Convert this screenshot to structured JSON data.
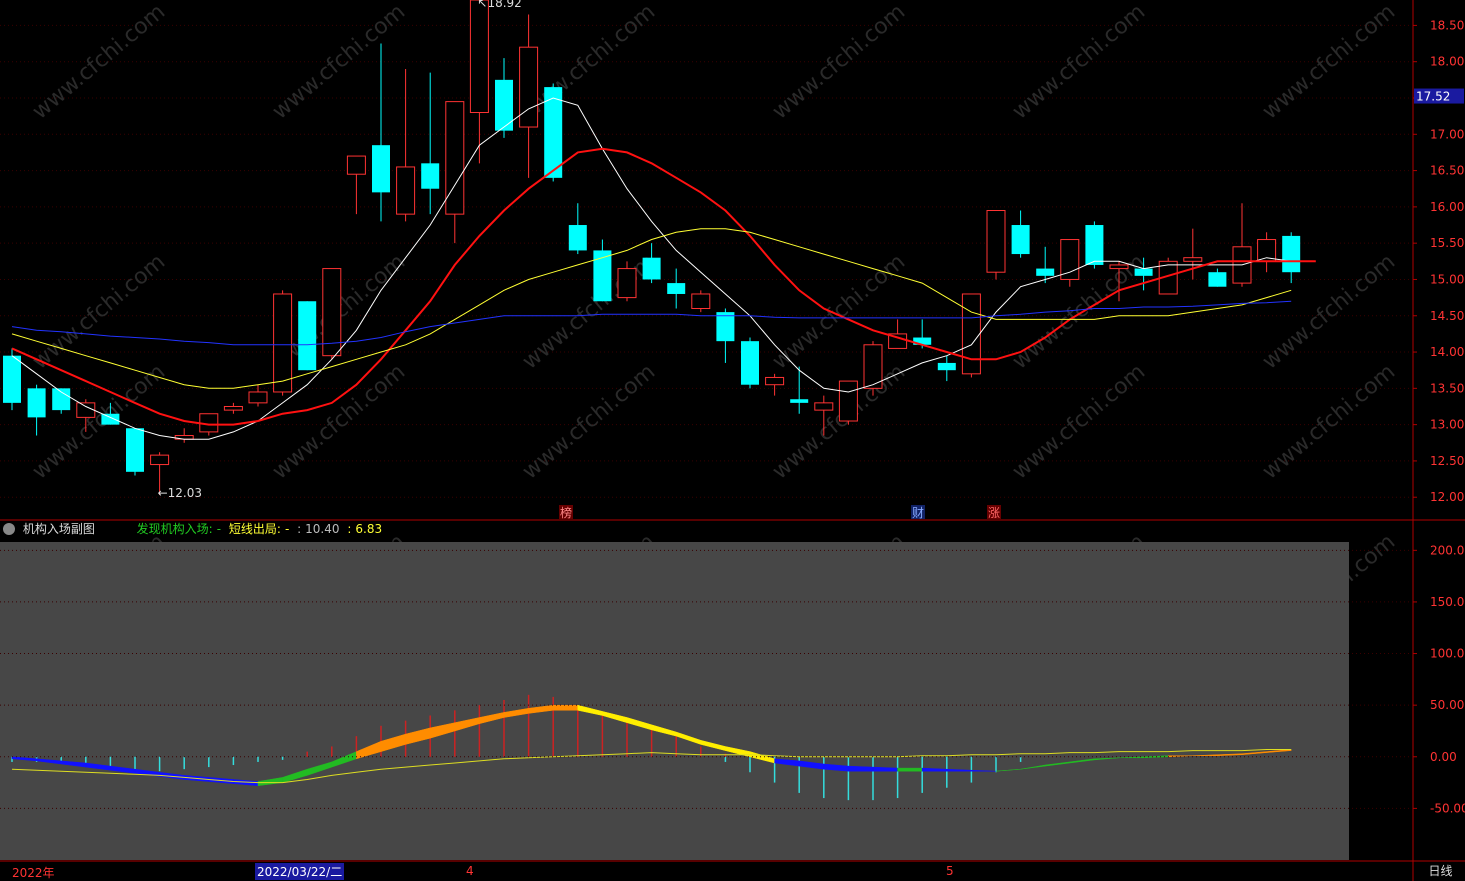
{
  "main_chart": {
    "price_axis_labels": [
      "18.50",
      "18.00",
      "17.50",
      "17.00",
      "16.50",
      "16.00",
      "15.50",
      "15.00",
      "14.50",
      "14.00",
      "13.50",
      "13.00",
      "12.50",
      "12.00"
    ],
    "current_price_tag": "17.52",
    "high_marker": "18.92",
    "low_marker": "12.03",
    "event_tags": [
      "榜",
      "财",
      "涨"
    ],
    "watermark": "www.cfchi.com"
  },
  "sub_chart": {
    "title": "机构入场副图",
    "legend": [
      {
        "label": "发现机构入场:",
        "value": "-",
        "color": "#22cc22"
      },
      {
        "label": "短线出局:",
        "value": "-",
        "color": "#ffff33"
      },
      {
        "label": ":",
        "value": "10.40",
        "color": "#bbbbbb"
      },
      {
        "label": ":",
        "value": "6.83",
        "color": "#ffff33"
      }
    ],
    "axis_labels": [
      "200.00",
      "150.00",
      "100.00",
      "50.00",
      "0.00",
      "-50.00"
    ]
  },
  "time_axis": {
    "labels": [
      "2022年",
      "2022/03/22/二",
      "4",
      "5"
    ],
    "period": "日线"
  },
  "chart_data": [
    {
      "type": "candlestick",
      "title": "",
      "ylim": [
        11.7,
        18.85
      ],
      "up_color": "#ff3333",
      "down_color": "#00ffff",
      "candles": [
        {
          "o": 13.95,
          "h": 14.05,
          "l": 13.2,
          "c": 13.3
        },
        {
          "o": 13.5,
          "h": 13.55,
          "l": 12.85,
          "c": 13.1
        },
        {
          "o": 13.5,
          "h": 13.5,
          "l": 13.15,
          "c": 13.2
        },
        {
          "o": 13.1,
          "h": 13.35,
          "l": 12.9,
          "c": 13.3
        },
        {
          "o": 13.15,
          "h": 13.3,
          "l": 13.0,
          "c": 13.0
        },
        {
          "o": 12.95,
          "h": 12.95,
          "l": 12.3,
          "c": 12.35
        },
        {
          "o": 12.45,
          "h": 12.62,
          "l": 12.03,
          "c": 12.58
        },
        {
          "o": 12.8,
          "h": 12.95,
          "l": 12.75,
          "c": 12.85
        },
        {
          "o": 12.9,
          "h": 13.15,
          "l": 12.85,
          "c": 13.15
        },
        {
          "o": 13.2,
          "h": 13.3,
          "l": 13.15,
          "c": 13.25
        },
        {
          "o": 13.3,
          "h": 13.55,
          "l": 13.25,
          "c": 13.45
        },
        {
          "o": 13.45,
          "h": 14.85,
          "l": 13.4,
          "c": 14.8
        },
        {
          "o": 14.7,
          "h": 14.7,
          "l": 13.75,
          "c": 13.75
        },
        {
          "o": 13.95,
          "h": 15.15,
          "l": 13.9,
          "c": 15.15
        },
        {
          "o": 16.45,
          "h": 16.7,
          "l": 15.9,
          "c": 16.7
        },
        {
          "o": 16.85,
          "h": 18.25,
          "l": 15.8,
          "c": 16.2
        },
        {
          "o": 15.9,
          "h": 17.9,
          "l": 15.8,
          "c": 16.55
        },
        {
          "o": 16.6,
          "h": 17.85,
          "l": 15.9,
          "c": 16.25
        },
        {
          "o": 15.9,
          "h": 17.45,
          "l": 15.5,
          "c": 17.45
        },
        {
          "o": 17.3,
          "h": 18.92,
          "l": 16.6,
          "c": 18.85
        },
        {
          "o": 17.75,
          "h": 18.05,
          "l": 16.95,
          "c": 17.05
        },
        {
          "o": 17.1,
          "h": 18.65,
          "l": 16.4,
          "c": 18.2
        },
        {
          "o": 17.65,
          "h": 17.7,
          "l": 16.35,
          "c": 16.4
        },
        {
          "o": 15.75,
          "h": 16.05,
          "l": 15.35,
          "c": 15.4
        },
        {
          "o": 15.4,
          "h": 15.55,
          "l": 14.7,
          "c": 14.7
        },
        {
          "o": 14.75,
          "h": 15.25,
          "l": 14.7,
          "c": 15.15
        },
        {
          "o": 15.3,
          "h": 15.5,
          "l": 14.95,
          "c": 15.0
        },
        {
          "o": 14.95,
          "h": 15.15,
          "l": 14.6,
          "c": 14.8
        },
        {
          "o": 14.6,
          "h": 14.85,
          "l": 14.55,
          "c": 14.8
        },
        {
          "o": 14.55,
          "h": 14.6,
          "l": 13.85,
          "c": 14.15
        },
        {
          "o": 14.15,
          "h": 14.2,
          "l": 13.5,
          "c": 13.55
        },
        {
          "o": 13.55,
          "h": 13.7,
          "l": 13.4,
          "c": 13.65
        },
        {
          "o": 13.35,
          "h": 13.8,
          "l": 13.15,
          "c": 13.3
        },
        {
          "o": 13.2,
          "h": 13.4,
          "l": 12.85,
          "c": 13.3
        },
        {
          "o": 13.05,
          "h": 13.55,
          "l": 13.0,
          "c": 13.6
        },
        {
          "o": 13.5,
          "h": 14.15,
          "l": 13.4,
          "c": 14.1
        },
        {
          "o": 14.05,
          "h": 14.45,
          "l": 14.05,
          "c": 14.25
        },
        {
          "o": 14.2,
          "h": 14.45,
          "l": 14.05,
          "c": 14.1
        },
        {
          "o": 13.85,
          "h": 13.95,
          "l": 13.6,
          "c": 13.75
        },
        {
          "o": 13.7,
          "h": 14.8,
          "l": 13.65,
          "c": 14.8
        },
        {
          "o": 15.1,
          "h": 15.95,
          "l": 15.0,
          "c": 15.95
        },
        {
          "o": 15.75,
          "h": 15.95,
          "l": 15.3,
          "c": 15.35
        },
        {
          "o": 15.15,
          "h": 15.45,
          "l": 14.95,
          "c": 15.05
        },
        {
          "o": 15.0,
          "h": 15.55,
          "l": 14.9,
          "c": 15.55
        },
        {
          "o": 15.75,
          "h": 15.8,
          "l": 15.15,
          "c": 15.2
        },
        {
          "o": 15.15,
          "h": 15.25,
          "l": 14.7,
          "c": 15.2
        },
        {
          "o": 15.15,
          "h": 15.3,
          "l": 14.85,
          "c": 15.05
        },
        {
          "o": 14.8,
          "h": 15.3,
          "l": 14.8,
          "c": 15.25
        },
        {
          "o": 15.25,
          "h": 15.7,
          "l": 15.0,
          "c": 15.3
        },
        {
          "o": 15.1,
          "h": 15.15,
          "l": 14.9,
          "c": 14.9
        },
        {
          "o": 14.95,
          "h": 16.05,
          "l": 14.9,
          "c": 15.45
        },
        {
          "o": 15.25,
          "h": 15.65,
          "l": 15.1,
          "c": 15.55
        },
        {
          "o": 15.6,
          "h": 15.65,
          "l": 14.95,
          "c": 15.1
        }
      ],
      "series": [
        {
          "color": "#ffffff",
          "width": 1,
          "values": [
            13.95,
            13.7,
            13.45,
            13.25,
            13.1,
            12.95,
            12.85,
            12.8,
            12.8,
            12.9,
            13.05,
            13.3,
            13.55,
            13.9,
            14.3,
            14.85,
            15.3,
            15.75,
            16.3,
            16.85,
            17.1,
            17.35,
            17.5,
            17.4,
            16.8,
            16.25,
            15.8,
            15.4,
            15.1,
            14.8,
            14.5,
            14.1,
            13.75,
            13.5,
            13.45,
            13.55,
            13.7,
            13.85,
            13.95,
            14.1,
            14.55,
            14.9,
            15.0,
            15.1,
            15.25,
            15.25,
            15.15,
            15.2,
            15.2,
            15.2,
            15.2,
            15.3,
            15.25
          ]
        },
        {
          "color": "#ff1111",
          "width": 2,
          "values": [
            14.05,
            13.9,
            13.75,
            13.6,
            13.45,
            13.3,
            13.15,
            13.05,
            13.0,
            13.0,
            13.05,
            13.15,
            13.2,
            13.3,
            13.55,
            13.9,
            14.3,
            14.7,
            15.2,
            15.6,
            15.95,
            16.25,
            16.5,
            16.75,
            16.8,
            16.75,
            16.6,
            16.4,
            16.2,
            15.95,
            15.6,
            15.2,
            14.85,
            14.6,
            14.45,
            14.3,
            14.2,
            14.1,
            14.0,
            13.9,
            13.9,
            14.0,
            14.2,
            14.45,
            14.65,
            14.85,
            14.95,
            15.05,
            15.15,
            15.25,
            15.25,
            15.25,
            15.25,
            15.25
          ]
        },
        {
          "color": "#ffff33",
          "width": 1,
          "values": [
            14.25,
            14.15,
            14.05,
            13.95,
            13.85,
            13.75,
            13.65,
            13.55,
            13.5,
            13.5,
            13.55,
            13.6,
            13.7,
            13.8,
            13.9,
            14.0,
            14.1,
            14.25,
            14.45,
            14.65,
            14.85,
            15.0,
            15.1,
            15.2,
            15.3,
            15.4,
            15.55,
            15.65,
            15.7,
            15.7,
            15.65,
            15.55,
            15.45,
            15.35,
            15.25,
            15.15,
            15.05,
            14.95,
            14.75,
            14.55,
            14.45,
            14.45,
            14.45,
            14.45,
            14.45,
            14.5,
            14.5,
            14.5,
            14.55,
            14.6,
            14.65,
            14.75,
            14.85
          ]
        },
        {
          "color": "#2233ff",
          "width": 1,
          "values": [
            14.35,
            14.3,
            14.28,
            14.25,
            14.22,
            14.2,
            14.18,
            14.15,
            14.13,
            14.1,
            14.1,
            14.1,
            14.1,
            14.12,
            14.15,
            14.2,
            14.28,
            14.35,
            14.4,
            14.45,
            14.5,
            14.5,
            14.5,
            14.5,
            14.52,
            14.52,
            14.52,
            14.52,
            14.5,
            14.5,
            14.5,
            14.48,
            14.47,
            14.47,
            14.47,
            14.47,
            14.47,
            14.47,
            14.47,
            14.47,
            14.5,
            14.52,
            14.55,
            14.57,
            14.6,
            14.6,
            14.62,
            14.62,
            14.63,
            14.65,
            14.67,
            14.68,
            14.7
          ]
        }
      ]
    },
    {
      "type": "area",
      "title": "机构入场副图",
      "ylim": [
        -100,
        210
      ],
      "upper": [
        0,
        -2,
        -4,
        -6,
        -9,
        -12,
        -15,
        -18,
        -20,
        -22,
        -24,
        -20,
        -12,
        -5,
        5,
        15,
        22,
        28,
        33,
        38,
        43,
        47,
        50,
        50,
        44,
        38,
        31,
        24,
        16,
        10,
        5,
        -2,
        -4,
        -7,
        -9,
        -10,
        -11,
        -11,
        -12,
        -13,
        -14,
        -12,
        -8,
        -5,
        -2,
        -1,
        0,
        1,
        1,
        2,
        3,
        5,
        7
      ],
      "lower": [
        -2,
        -4,
        -7,
        -10,
        -13,
        -16,
        -19,
        -22,
        -24,
        -26,
        -28,
        -25,
        -18,
        -10,
        -2,
        5,
        12,
        18,
        25,
        32,
        38,
        42,
        45,
        45,
        40,
        33,
        26,
        20,
        12,
        6,
        0,
        -6,
        -9,
        -12,
        -14,
        -14,
        -14,
        -14,
        -14,
        -14,
        -14,
        -12,
        -9,
        -6,
        -3,
        -1,
        -1,
        0,
        1,
        1,
        2,
        4,
        6
      ],
      "pos_bars": [
        0,
        0,
        0,
        0,
        0,
        0,
        0,
        0,
        0,
        0,
        0,
        0,
        5,
        10,
        20,
        30,
        35,
        40,
        45,
        50,
        55,
        60,
        58,
        50,
        40,
        35,
        30,
        20,
        10,
        3,
        0,
        0,
        0,
        0,
        0,
        0,
        0,
        0,
        0,
        0,
        0,
        0,
        0,
        0,
        0,
        0,
        0,
        0,
        0,
        0,
        0,
        0,
        0
      ],
      "neg_bars": [
        -5,
        -5,
        -5,
        -8,
        -10,
        -12,
        -14,
        -12,
        -10,
        -8,
        -5,
        -3,
        0,
        0,
        0,
        0,
        0,
        0,
        0,
        0,
        0,
        0,
        0,
        0,
        0,
        0,
        0,
        0,
        0,
        -5,
        -15,
        -25,
        -35,
        -40,
        -42,
        -42,
        -40,
        -35,
        -30,
        -25,
        -15,
        -5,
        0,
        0,
        0,
        0,
        0,
        0,
        0,
        0,
        0,
        0,
        0
      ],
      "slow_line": [
        -12,
        -13,
        -14,
        -15,
        -16,
        -17,
        -18,
        -20,
        -22,
        -24,
        -25,
        -25,
        -22,
        -18,
        -15,
        -12,
        -10,
        -8,
        -6,
        -4,
        -2,
        -1,
        0,
        1,
        2,
        3,
        4,
        3,
        2,
        2,
        2,
        1,
        0,
        0,
        0,
        0,
        0,
        1,
        1,
        2,
        2,
        3,
        3,
        4,
        4,
        5,
        5,
        5,
        6,
        6,
        6,
        7,
        7
      ]
    }
  ]
}
